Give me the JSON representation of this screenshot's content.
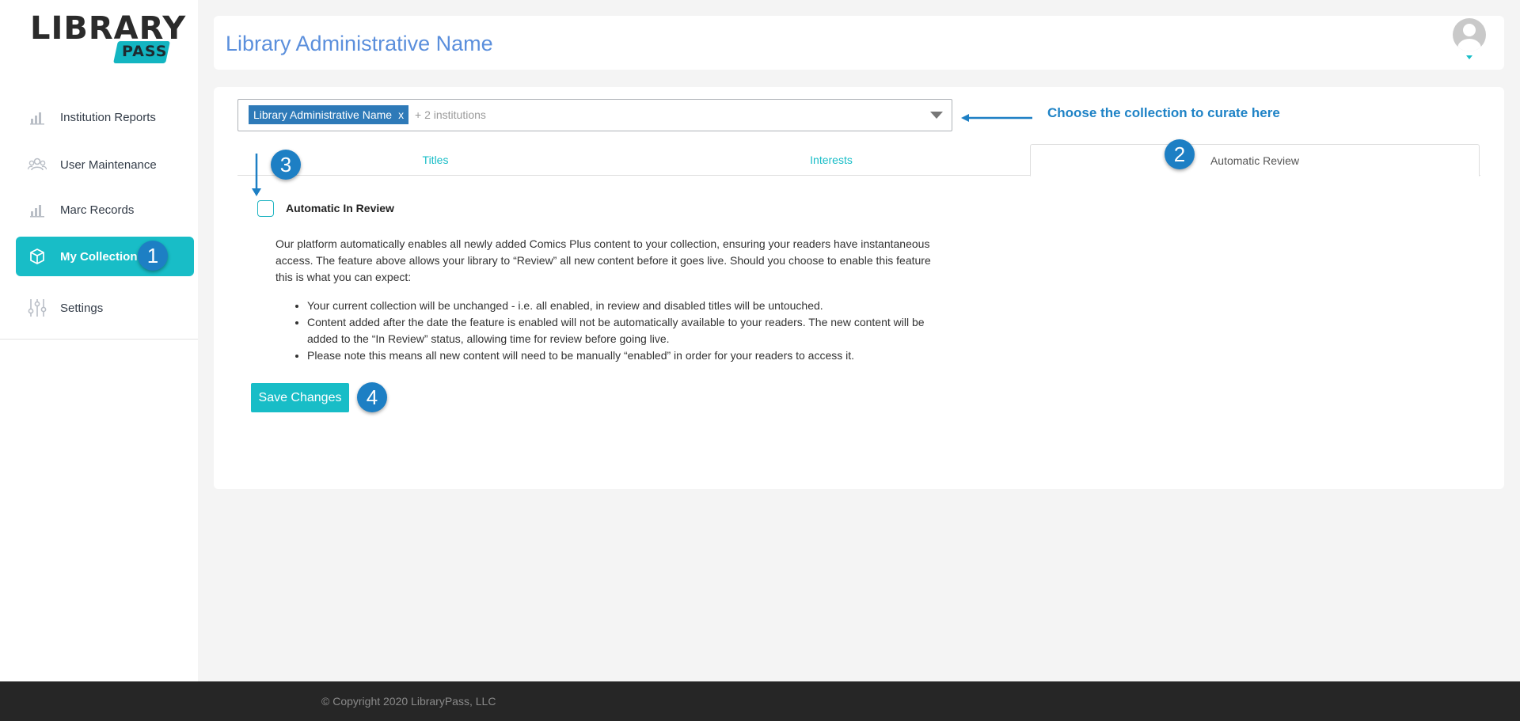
{
  "brand": {
    "logo_word": "LIBRARY",
    "logo_sub": "PASS",
    "accent": "#18bdc7",
    "title_color": "#5b8fdc",
    "annotation_color": "#1d7fc4"
  },
  "sidebar": {
    "items": [
      {
        "label": "Institution Reports",
        "icon": "bar-chart-icon"
      },
      {
        "label": "User Maintenance",
        "icon": "users-icon"
      },
      {
        "label": "Marc Records",
        "icon": "bar-chart-icon"
      },
      {
        "label": "My Collection",
        "icon": "box-icon",
        "active": true
      },
      {
        "label": "Settings",
        "icon": "sliders-icon"
      }
    ]
  },
  "header": {
    "title": "Library Administrative Name",
    "avatar": "user-avatar-icon"
  },
  "collection_select": {
    "selected_chip": "Library Administrative Name",
    "chip_remove": "x",
    "more_text": "+ 2 institutions"
  },
  "hint": {
    "text": "Choose the collection to curate here"
  },
  "tabs": [
    {
      "label": "Titles"
    },
    {
      "label": "Interests"
    },
    {
      "label": "Automatic Review",
      "active": true
    }
  ],
  "automatic_review": {
    "checkbox_label": "Automatic In Review",
    "checked": false,
    "description": "Our platform automatically enables all newly added Comics Plus content to your collection, ensuring your readers have instantaneous access. The feature above allows your library to “Review” all new content before it goes live. Should you choose to enable this feature this is what you can expect:",
    "bullets": [
      "Your current collection will be unchanged - i.e. all enabled, in review and disabled titles will be untouched.",
      "Content added after the date the feature is enabled will not be automatically available to your readers. The new content will be added to the “In Review” status, allowing time for review before going live.",
      "Please note this means all new content will need to be manually “enabled” in order for your readers to access it."
    ],
    "save_label": "Save Changes"
  },
  "annotations": {
    "step1": "1",
    "step2": "2",
    "step3": "3",
    "step4": "4"
  },
  "footer": {
    "copyright": "© Copyright 2020 LibraryPass, LLC"
  }
}
